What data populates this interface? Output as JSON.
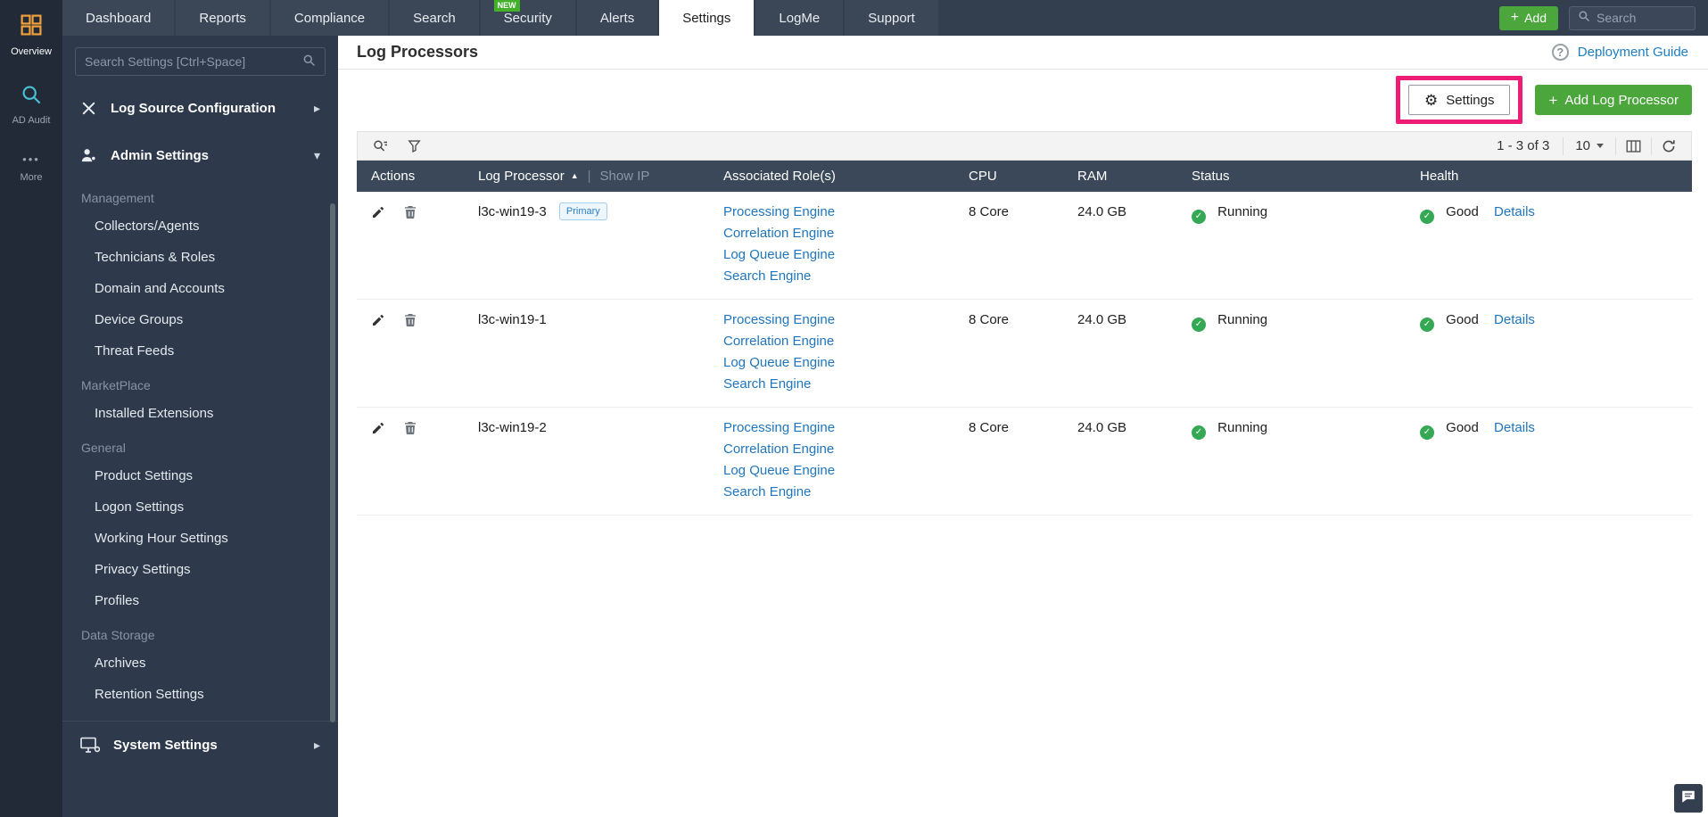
{
  "colors": {
    "nav_bg": "#333e4f",
    "rail_bg": "#212a36",
    "sidebar_bg": "#2e3a4b",
    "table_header_bg": "#3a4859",
    "accent_green": "#4ba63c",
    "link_blue": "#2076bc",
    "status_green": "#35a854",
    "annotation_pink": "#ee1c77"
  },
  "icons": {
    "plus": "+",
    "gear": "⚙",
    "check": "✓",
    "sort_asc": "▲",
    "chevron_right": "▸",
    "chevron_down": "▾",
    "pipe": "|",
    "help": "?",
    "ellipsis": "•••"
  },
  "rail": {
    "items": [
      {
        "label": "Overview"
      },
      {
        "label": "AD Audit"
      },
      {
        "label": "More"
      }
    ]
  },
  "nav": {
    "tabs": [
      {
        "label": "Dashboard"
      },
      {
        "label": "Reports"
      },
      {
        "label": "Compliance"
      },
      {
        "label": "Search"
      },
      {
        "label": "Security",
        "badge": "NEW"
      },
      {
        "label": "Alerts"
      },
      {
        "label": "Settings"
      },
      {
        "label": "LogMe"
      },
      {
        "label": "Support"
      }
    ],
    "active_tab": "Settings",
    "add_button_label": "Add",
    "search_placeholder": "Search"
  },
  "sidebar": {
    "search_placeholder": "Search Settings [Ctrl+Space]",
    "groups": [
      {
        "label": "Log Source Configuration"
      },
      {
        "label": "Admin Settings"
      }
    ],
    "sections": [
      {
        "title": "Management",
        "items": [
          "Collectors/Agents",
          "Technicians & Roles",
          "Domain and Accounts",
          "Device Groups",
          "Threat Feeds"
        ]
      },
      {
        "title": "MarketPlace",
        "items": [
          "Installed Extensions"
        ]
      },
      {
        "title": "General",
        "items": [
          "Product Settings",
          "Logon Settings",
          "Working Hour Settings",
          "Privacy Settings",
          "Profiles"
        ]
      },
      {
        "title": "Data Storage",
        "items": [
          "Archives",
          "Retention Settings"
        ]
      }
    ],
    "footer_group": {
      "label": "System Settings"
    }
  },
  "main": {
    "title": "Log Processors",
    "deployment_guide_label": "Deployment Guide",
    "settings_button_label": "Settings",
    "add_processor_label": "Add Log Processor",
    "toolbar": {
      "range": "1 - 3 of 3",
      "page_size": "10"
    },
    "table": {
      "headers": {
        "actions": "Actions",
        "log_processor": "Log Processor",
        "show_ip": "Show IP",
        "roles": "Associated Role(s)",
        "cpu": "CPU",
        "ram": "RAM",
        "status": "Status",
        "health": "Health"
      },
      "rows": [
        {
          "name": "l3c-win19-3",
          "badge": "Primary",
          "roles": [
            "Processing Engine",
            "Correlation Engine",
            "Log Queue Engine",
            "Search Engine"
          ],
          "cpu": "8 Core",
          "ram": "24.0 GB",
          "status": "Running",
          "health": "Good",
          "details_label": "Details"
        },
        {
          "name": "l3c-win19-1",
          "badge": "",
          "roles": [
            "Processing Engine",
            "Correlation Engine",
            "Log Queue Engine",
            "Search Engine"
          ],
          "cpu": "8 Core",
          "ram": "24.0 GB",
          "status": "Running",
          "health": "Good",
          "details_label": "Details"
        },
        {
          "name": "l3c-win19-2",
          "badge": "",
          "roles": [
            "Processing Engine",
            "Correlation Engine",
            "Log Queue Engine",
            "Search Engine"
          ],
          "cpu": "8 Core",
          "ram": "24.0 GB",
          "status": "Running",
          "health": "Good",
          "details_label": "Details"
        }
      ]
    }
  }
}
